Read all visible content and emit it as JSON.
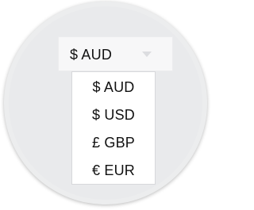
{
  "currency_selector": {
    "selected_label": "$ AUD",
    "chevron_icon": "chevron-down-icon",
    "options": [
      {
        "label": "$ AUD"
      },
      {
        "label": "$ USD"
      },
      {
        "label": "£ GBP"
      },
      {
        "label": "€ EUR"
      }
    ]
  }
}
